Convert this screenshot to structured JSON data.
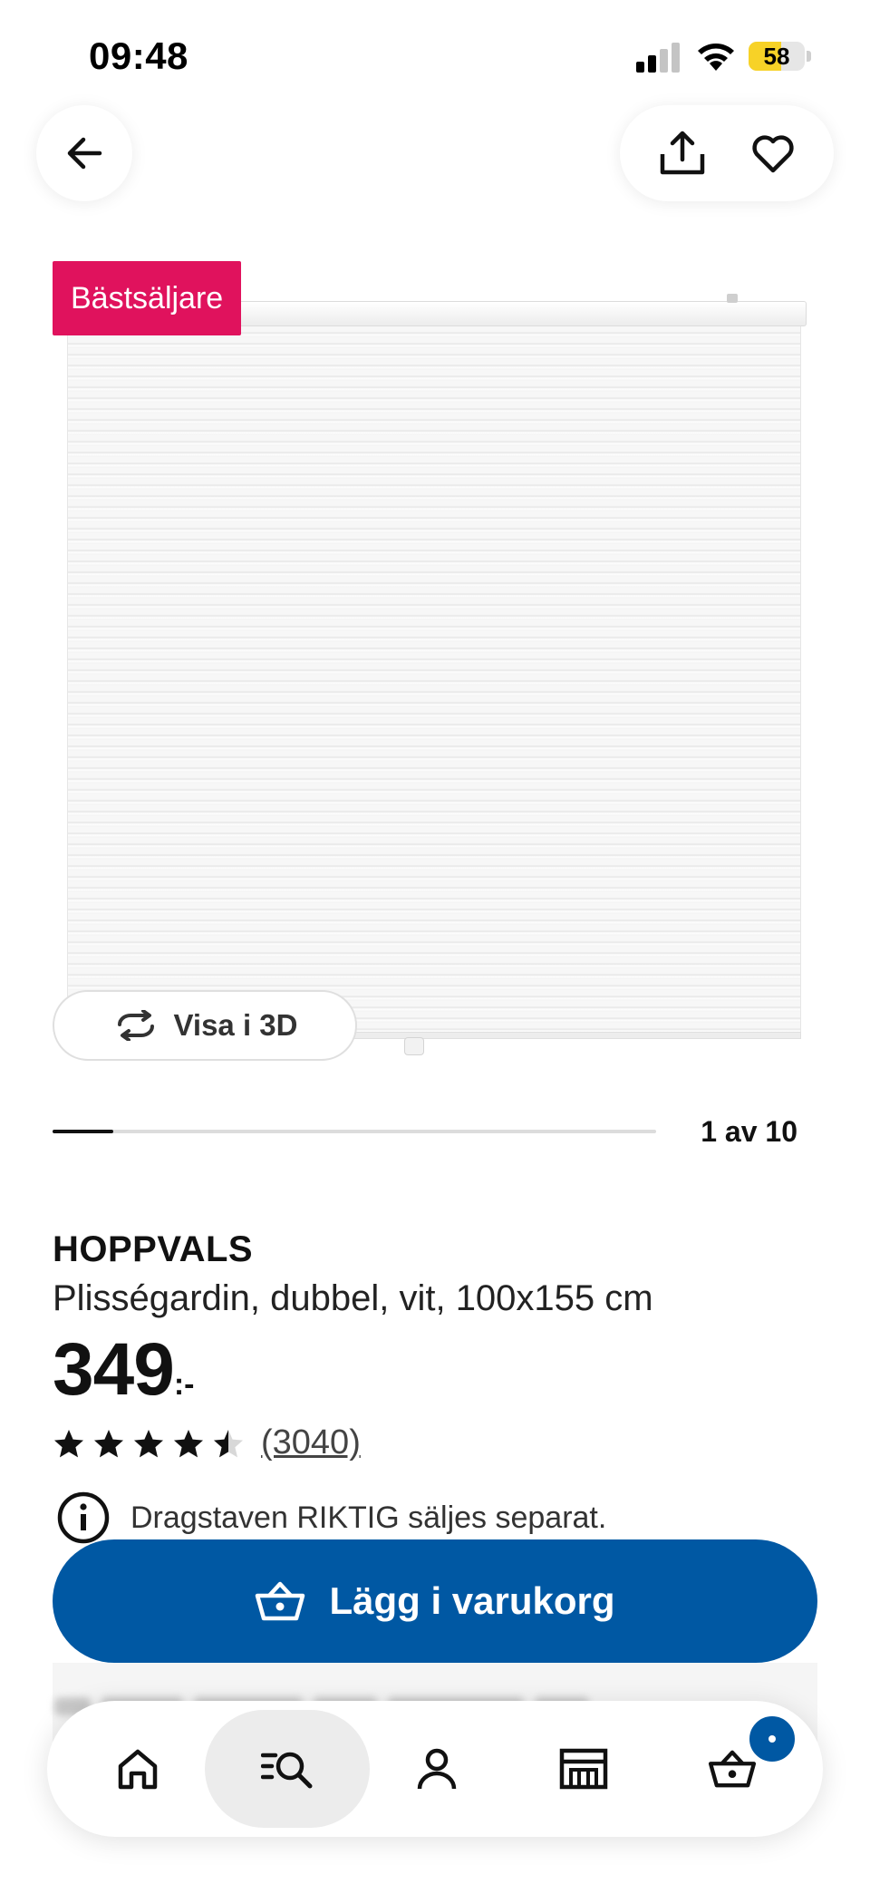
{
  "status_bar": {
    "time": "09:48",
    "battery_level": "58",
    "battery_fraction": 0.58
  },
  "top_actions": {
    "back_icon": "arrow-left-icon",
    "share_icon": "share-icon",
    "favorite_icon": "heart-icon"
  },
  "product": {
    "badge": "Bästsäljare",
    "view_3d_label": "Visa i 3D",
    "gallery_position": "1 av 10",
    "gallery_index": 1,
    "gallery_total": 10,
    "name": "HOPPVALS",
    "description": "Plisségardin, dubbel, vit, 100x155 cm",
    "price": "349",
    "price_suffix": ":-",
    "rating": 4.5,
    "rating_max": 5,
    "review_count": "(3040)",
    "notice": "Dragstaven RIKTIG säljes separat."
  },
  "cart_button": {
    "label": "Lägg i varukorg",
    "icon": "basket-icon"
  },
  "bottom_nav": {
    "items": [
      {
        "icon": "home-icon"
      },
      {
        "icon": "search-list-icon",
        "active": true
      },
      {
        "icon": "profile-icon"
      },
      {
        "icon": "store-icon"
      },
      {
        "icon": "basket-icon"
      }
    ]
  },
  "colors": {
    "brand_blue": "#0058a3",
    "badge_pink": "#e0125d",
    "battery_yellow": "#f7d227"
  }
}
